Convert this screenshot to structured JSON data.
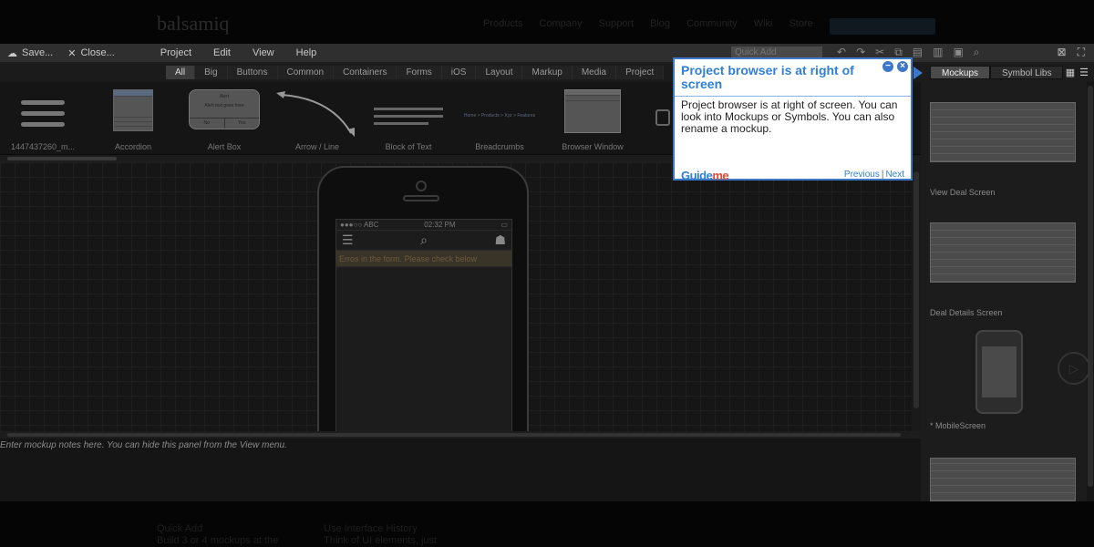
{
  "site": {
    "logo": "balsamiq",
    "nav": [
      "Products",
      "Company",
      "Support",
      "Blog",
      "Community",
      "Wiki",
      "Store"
    ]
  },
  "toolbar": {
    "save_label": "Save...",
    "close_label": "Close...",
    "menus": [
      "Project",
      "Edit",
      "View",
      "Help"
    ],
    "quick_add_placeholder": "Quick Add"
  },
  "filter_tabs": [
    "All",
    "Big",
    "Buttons",
    "Common",
    "Containers",
    "Forms",
    "iOS",
    "Layout",
    "Markup",
    "Media",
    "Project"
  ],
  "components": [
    {
      "label": "1447437260_m...",
      "icon": "hamburger-menu-icon"
    },
    {
      "label": "Accordion",
      "icon": "accordion-icon"
    },
    {
      "label": "Alert Box",
      "icon": "alert-box-icon"
    },
    {
      "label": "Arrow / Line",
      "icon": "arrow-line-icon"
    },
    {
      "label": "Block of Text",
      "icon": "block-of-text-icon"
    },
    {
      "label": "Breadcrumbs",
      "icon": "breadcrumbs-icon"
    },
    {
      "label": "Browser Window",
      "icon": "browser-window-icon"
    }
  ],
  "alert_thumb": {
    "title": "Alert",
    "text": "Alert text goes here",
    "no": "No",
    "yes": "Yes"
  },
  "breadcrumb_thumb": "Home > Products > Xyz > Features",
  "phone": {
    "signal": "●●●○○ ABC",
    "time": "02:32 PM",
    "error_text": "Erros in the form. Please check below"
  },
  "notes_placeholder": "Enter mockup notes here. You can hide this panel from the View menu.",
  "right_panel": {
    "tabs": [
      "Mockups",
      "Symbol Libs"
    ],
    "mockups": [
      "View Deal Screen",
      "Deal Details Screen",
      "* MobileScreen"
    ]
  },
  "popup": {
    "title": "Project browser is at right of screen",
    "body": "Project browser is at right of screen. You can look into Mockups or Symbols. You can also rename a mockup.",
    "logo_a": "Guide",
    "logo_b": "me",
    "prev": "Previous",
    "next": "Next"
  },
  "bottom": {
    "col1_title": "Quick Add",
    "col1_text": "Build 3 or 4 mockups at the",
    "col2_title": "Use Interface History",
    "col2_text": "Think of UI elements, just"
  },
  "colors": {
    "accent": "#3d78c8",
    "popup_title": "#2f7fd8",
    "logo_me": "#e04a2f"
  }
}
